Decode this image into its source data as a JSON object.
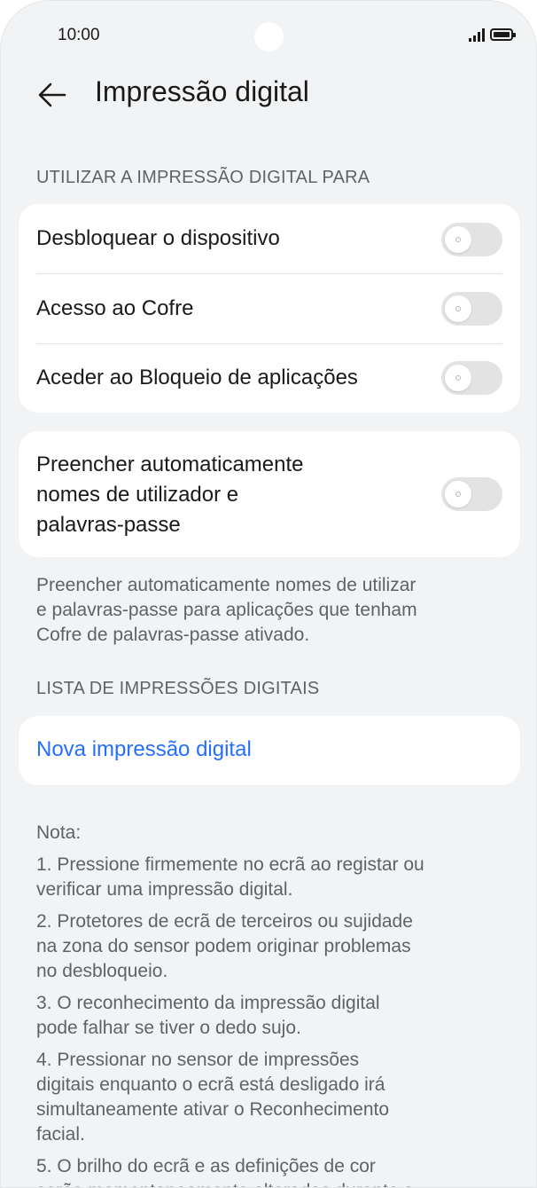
{
  "status_bar": {
    "time": "10:00"
  },
  "header": {
    "title": "Impressão digital"
  },
  "use_section": {
    "title": "UTILIZAR A IMPRESSÃO DIGITAL PARA",
    "items": [
      {
        "label": "Desbloquear o dispositivo",
        "enabled": false
      },
      {
        "label": "Acesso ao Cofre",
        "enabled": false
      },
      {
        "label": "Aceder ao Bloqueio de aplicações",
        "enabled": false
      }
    ]
  },
  "autofill": {
    "label_lines": [
      "Preencher automaticamente",
      "nomes de utilizador e",
      "palavras-passe"
    ],
    "enabled": false,
    "caption_lines": [
      "Preencher automaticamente nomes de utilizar",
      "e palavras-passe para aplicações que tenham",
      "Cofre de palavras-passe ativado."
    ]
  },
  "list_section": {
    "title": "LISTA DE IMPRESSÕES DIGITAIS",
    "new_label": "Nova impressão digital"
  },
  "notes": {
    "title": "Nota:",
    "items": [
      [
        "1. Pressione firmemente no ecrã ao registar ou",
        "verificar uma impressão digital."
      ],
      [
        "2. Protetores de ecrã de terceiros ou sujidade",
        "na zona do sensor podem originar problemas",
        "no desbloqueio."
      ],
      [
        "3. O reconhecimento da impressão digital",
        "pode falhar se tiver o dedo sujo."
      ],
      [
        "4. Pressionar no sensor de impressões",
        "digitais enquanto o ecrã está desligado irá",
        "simultaneamente ativar o Reconhecimento",
        "facial."
      ],
      [
        "5. O brilho do ecrã e as definições de cor",
        "serão momentaneamente alteradas durante a"
      ]
    ]
  }
}
